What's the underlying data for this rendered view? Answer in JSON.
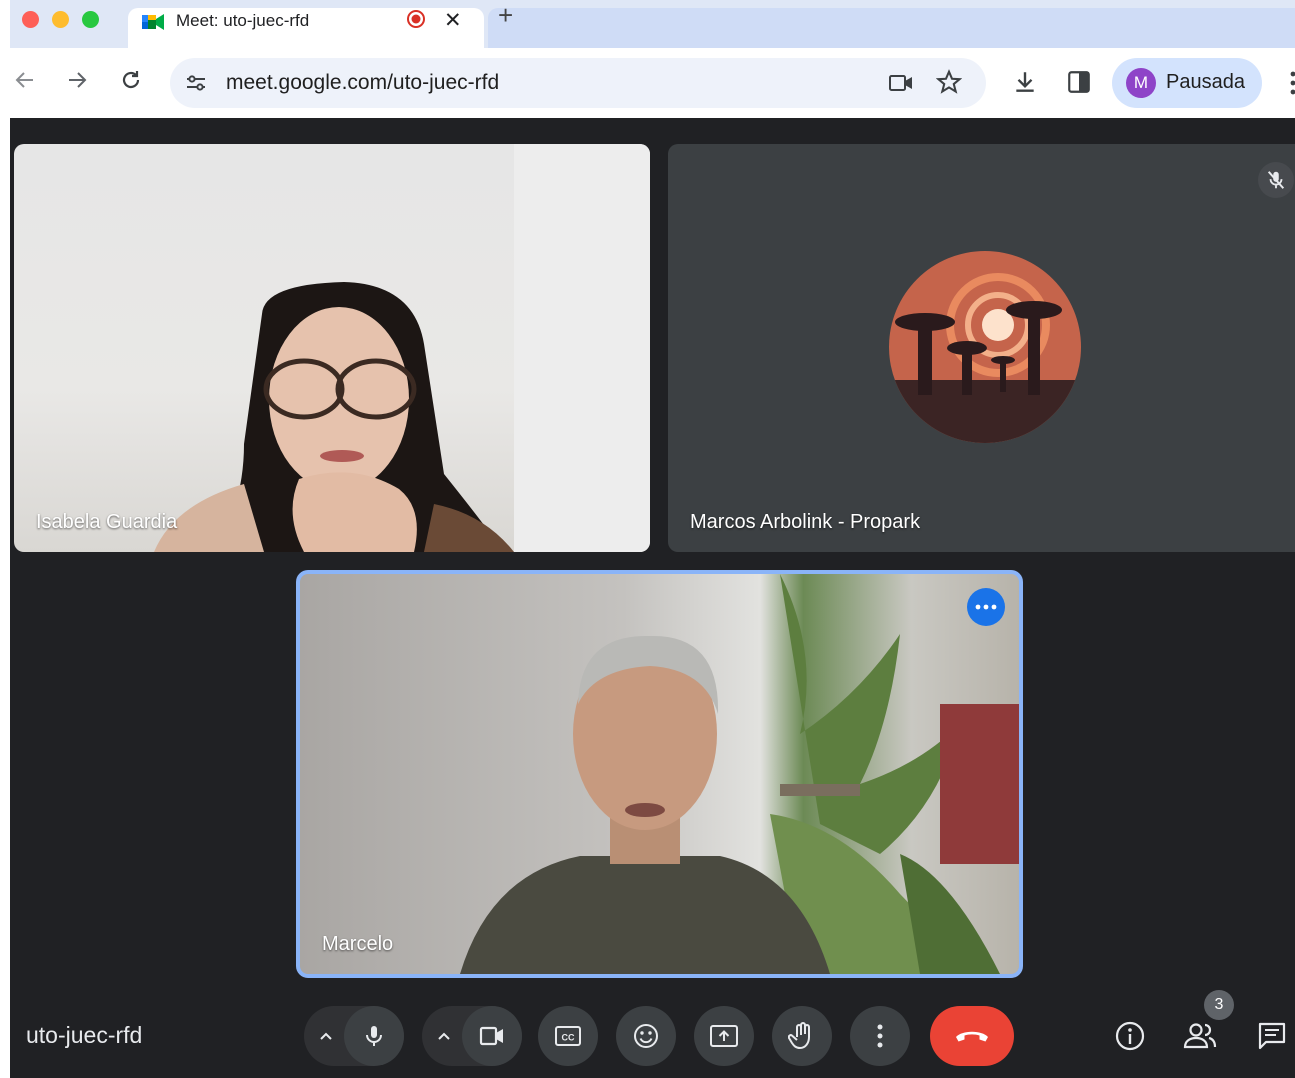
{
  "browser": {
    "tab": {
      "title": "Meet: uto-juec-rfd",
      "favicon": "google-meet-icon",
      "recording_indicator": "record-icon",
      "close_glyph": "✕"
    },
    "new_tab_glyph": "+",
    "address_bar": {
      "url": "meet.google.com/uto-juec-rfd"
    },
    "profile": {
      "initial": "M",
      "label": "Pausada"
    },
    "icons": [
      "back-icon",
      "forward-icon",
      "reload-icon",
      "site-settings-icon",
      "camera-icon",
      "bookmark-star-icon",
      "download-icon",
      "side-panel-icon",
      "more-vert-icon"
    ]
  },
  "meet": {
    "participants": [
      {
        "name": "Isabela Guardia",
        "video": true
      },
      {
        "name": "Marcos Arbolink - Propark",
        "video": false,
        "muted": true
      },
      {
        "name": "Marcelo",
        "video": true,
        "active_speaker": true
      }
    ],
    "meeting_code": "uto-juec-rfd",
    "participant_count": "3",
    "controls": [
      "mic",
      "camera",
      "captions",
      "emoji",
      "present",
      "raise-hand",
      "more-options",
      "leave-call"
    ],
    "colors": {
      "stage": "#202124",
      "end_call": "#ea4335",
      "active_border": "#8ab4f8",
      "accent": "#1a73e8"
    }
  }
}
